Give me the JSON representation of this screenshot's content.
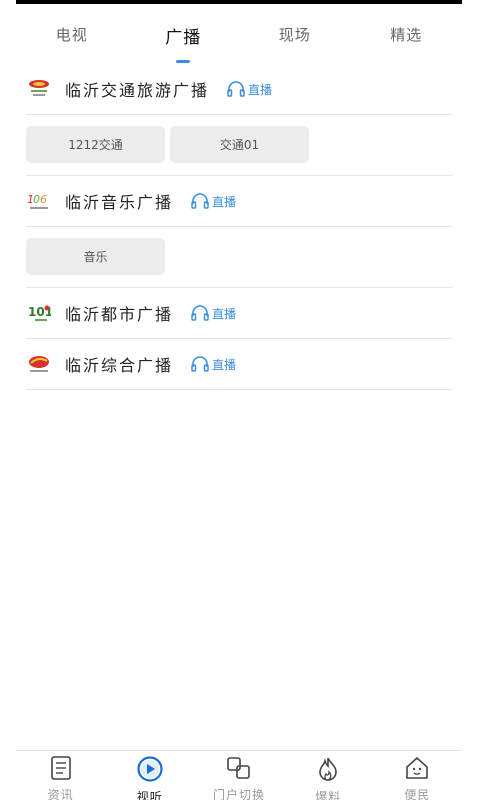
{
  "tabs": [
    {
      "label": "电视"
    },
    {
      "label": "广播"
    },
    {
      "label": "现场"
    },
    {
      "label": "精选"
    }
  ],
  "active_tab": "广播",
  "accent_color": "#3b8fe0",
  "stations": [
    {
      "name": "临沂交通旅游广播",
      "live": "直播",
      "logo_icon": "traffic-radio-logo",
      "programs": [
        {
          "label": "1212交通"
        },
        {
          "label": "交通01"
        }
      ]
    },
    {
      "name": "临沂音乐广播",
      "live": "直播",
      "logo_icon": "music-radio-logo",
      "programs": [
        {
          "label": "音乐"
        }
      ]
    },
    {
      "name": "临沂都市广播",
      "live": "直播",
      "logo_icon": "urban-radio-logo",
      "programs": []
    },
    {
      "name": "临沂综合广播",
      "live": "直播",
      "logo_icon": "general-radio-logo",
      "programs": []
    }
  ],
  "bottom_nav": [
    {
      "label": "资讯",
      "icon": "news-icon"
    },
    {
      "label": "视听",
      "icon": "play-icon"
    },
    {
      "label": "门户切换",
      "icon": "switch-icon"
    },
    {
      "label": "爆料",
      "icon": "flame-icon"
    },
    {
      "label": "便民",
      "icon": "home-icon"
    }
  ],
  "active_nav": "视听"
}
